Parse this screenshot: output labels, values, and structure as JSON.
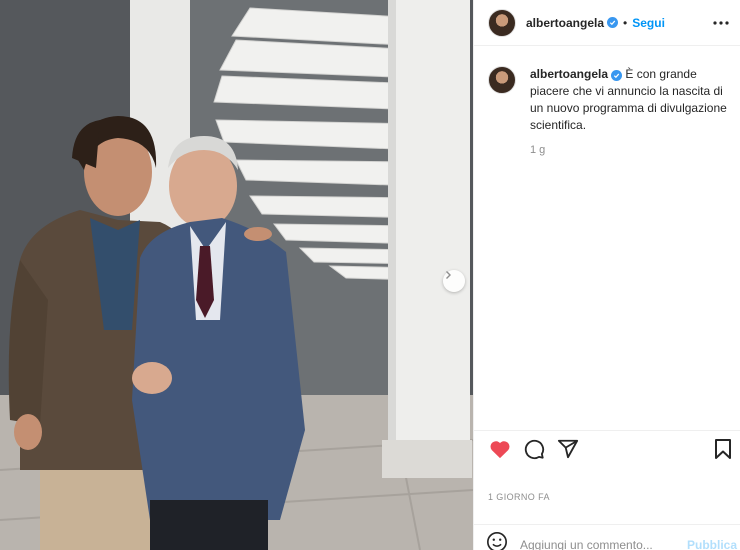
{
  "post": {
    "username": "albertoangela",
    "verified": true,
    "follow_label": "Segui",
    "dot": "•",
    "caption_text": "È con grande piacere che vi annuncio la nascita di un nuovo programma di divulgazione scientifica.",
    "caption_time": "1 g",
    "timestamp": "1 GIORNO FA",
    "liked": true
  },
  "comment": {
    "placeholder": "Aggiungi un commento...",
    "publish_label": "Pubblica"
  },
  "icons": {
    "verified": "verified-badge-icon",
    "more": "more-options-icon",
    "like": "heart-icon",
    "comment": "comment-icon",
    "share": "share-icon",
    "save": "bookmark-icon",
    "emoji": "emoji-icon",
    "next": "chevron-right-icon"
  },
  "colors": {
    "accent": "#0095f6",
    "like": "#ed4956",
    "verified": "#3897f0",
    "muted": "#8e8e8e"
  }
}
